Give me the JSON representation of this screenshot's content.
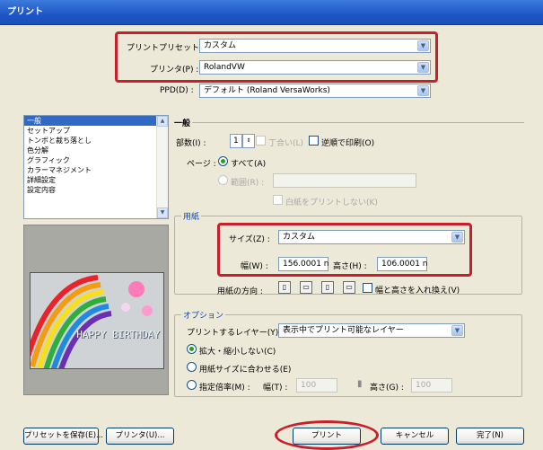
{
  "window": {
    "title": "プリント"
  },
  "top": {
    "preset_label": "プリントプリセット(S) :",
    "preset_value": "カスタム",
    "printer_label": "プリンタ(P) :",
    "printer_value": "RolandVW",
    "ppd_label": "PPD(D) :",
    "ppd_value": "デフォルト (Roland VersaWorks)"
  },
  "sidebar": {
    "items": [
      {
        "label": "一般",
        "selected": true
      },
      {
        "label": "セットアップ"
      },
      {
        "label": "トンボと裁ち落とし"
      },
      {
        "label": "色分解"
      },
      {
        "label": "グラフィック"
      },
      {
        "label": "カラーマネジメント"
      },
      {
        "label": "詳細設定"
      },
      {
        "label": "設定内容"
      }
    ]
  },
  "preview": {
    "card_text": "HAPPY BIRTHDAY"
  },
  "general": {
    "section_title": "一般",
    "copies_label": "部数(I) :",
    "copies_value": "1",
    "collate_label": "丁合い(L)",
    "reverse_label": "逆順で印刷(O)",
    "pages_label": "ページ :",
    "all_label": "すべて(A)",
    "range_label": "範囲(R) :",
    "print_blank_label": "白紙をプリントしない(K)"
  },
  "paper": {
    "section_title": "用紙",
    "size_label": "サイズ(Z) :",
    "size_value": "カスタム",
    "width_label": "幅(W) :",
    "width_value": "156.0001 n",
    "height_label": "高さ(H) :",
    "height_value": "106.0001 n",
    "orientation_label": "用紙の方向 :",
    "swap_label": "幅と高さを入れ換え(V)"
  },
  "options": {
    "section_title": "オプション",
    "layers_label": "プリントするレイヤー(Y) :",
    "layers_value": "表示中でプリント可能なレイヤー",
    "no_scale_label": "拡大・縮小しない(C)",
    "fit_label": "用紙サイズに合わせる(E)",
    "custom_scale_label": "指定倍率(M) :",
    "w_label": "幅(T) :",
    "w_value": "100",
    "h_label": "高さ(G) :",
    "h_value": "100"
  },
  "buttons": {
    "save_preset": "プリセットを保存(E)...",
    "printer": "プリンタ(U)...",
    "print": "プリント",
    "cancel": "キャンセル",
    "done": "完了(N)"
  },
  "colors": {
    "title_bar": "#1e56c8",
    "highlight": "#c8202a",
    "selection": "#3169c6"
  }
}
